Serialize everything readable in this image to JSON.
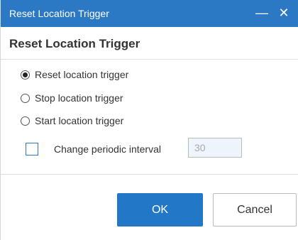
{
  "window": {
    "titlebar_text": "Reset Location Trigger",
    "minimize_glyph": "—",
    "close_glyph": "✕"
  },
  "dialog": {
    "heading": "Reset Location Trigger",
    "options": [
      {
        "label": "Reset location trigger",
        "selected": true
      },
      {
        "label": "Stop location trigger",
        "selected": false
      },
      {
        "label": "Start location trigger",
        "selected": false
      }
    ],
    "periodic": {
      "label": "Change periodic interval",
      "checked": false,
      "value": "30"
    }
  },
  "buttons": {
    "ok": "OK",
    "cancel": "Cancel"
  },
  "colors": {
    "titlebar": "#2b78c5",
    "primary_button": "#2277c7"
  },
  "icons": {
    "minimize": "minimize-icon",
    "close": "close-icon"
  }
}
